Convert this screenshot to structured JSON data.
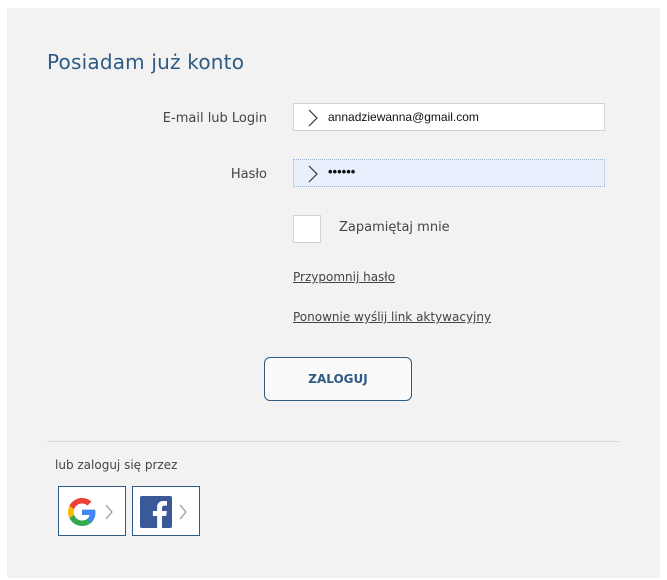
{
  "login": {
    "title": "Posiadam już konto",
    "email_label": "E-mail lub Login",
    "email_value": "annadziewanna@gmail.com",
    "password_label": "Hasło",
    "password_value": "••••••",
    "remember_label": "Zapamiętaj mnie",
    "remind_password_link": "Przypomnij hasło",
    "resend_activation_link": "Ponownie wyślij link aktywacyjny",
    "submit_label": "ZALOGUJ"
  },
  "social": {
    "label": "lub zaloguj się przez",
    "providers": [
      {
        "name": "google",
        "icon": "google-icon"
      },
      {
        "name": "facebook",
        "icon": "facebook-icon"
      }
    ]
  },
  "colors": {
    "accent": "#2d5b83",
    "panel": "#f2f2f2",
    "active_field": "#e8f0fe",
    "facebook": "#3b5998"
  }
}
